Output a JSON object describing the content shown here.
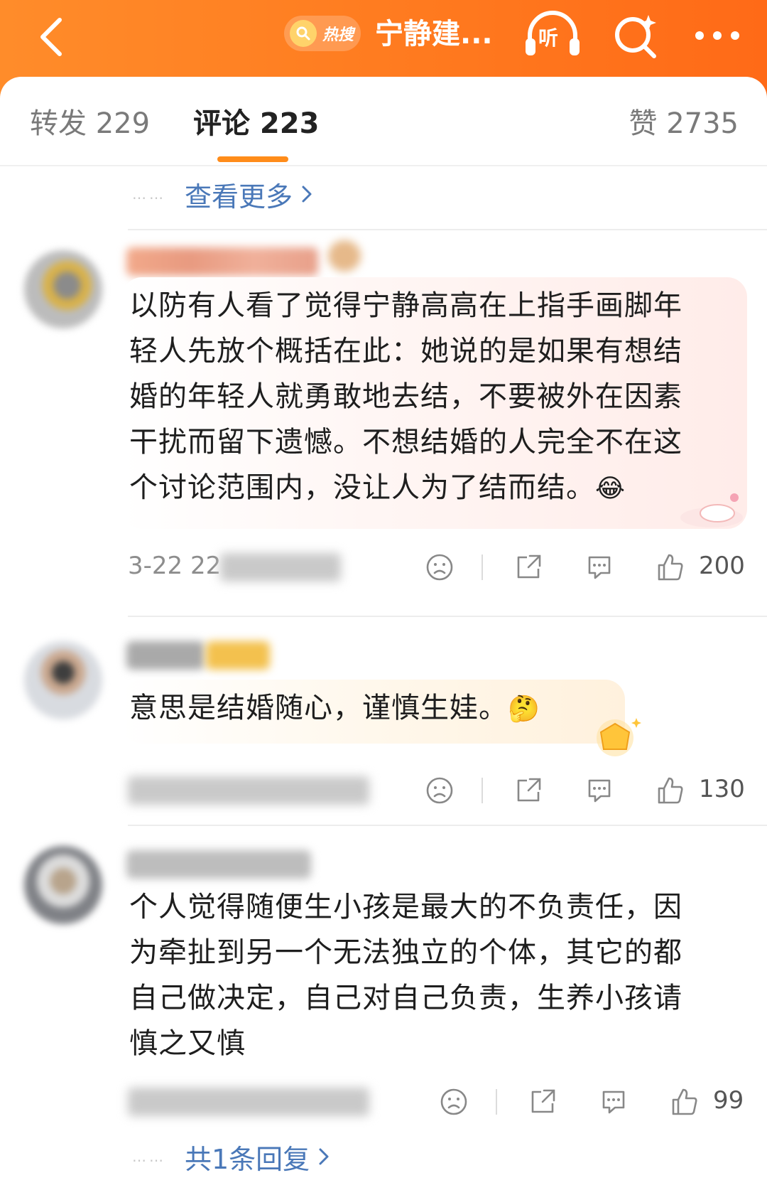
{
  "header": {
    "hot_badge_label": "热搜",
    "title": "宁静建...",
    "listen_label": "听",
    "icons": [
      "back-chevron-icon",
      "search-icon",
      "headphones-icon",
      "ai-search-icon",
      "more-dots-icon"
    ],
    "colors": {
      "bar": "#ff7a1f",
      "accent": "#ff8c1a",
      "link": "#4a78b8"
    }
  },
  "tabs": [
    {
      "label": "转发 229"
    },
    {
      "label": "评论 223"
    },
    {
      "label": "赞 2735"
    }
  ],
  "see_more": {
    "label": "查看更多"
  },
  "comments": [
    {
      "text_lines": [
        "以防有人看了觉得宁静高高在上指手画脚年",
        "轻人先放个概括在此：她说的是如果有想结",
        "婚的年轻人就勇敢地去结，不要被外在因素",
        "干扰而留下遗憾。不想结婚的人完全不在这",
        "个讨论范围内，没让人为了结而结。"
      ],
      "emoji": "😂",
      "timestamp": "3-22 22",
      "likes": "200"
    },
    {
      "text_lines": [
        "意思是结婚随心，谨慎生娃。"
      ],
      "emoji": "🤔",
      "timestamp": "",
      "likes": "130"
    },
    {
      "text_lines": [
        "个人觉得随便生小孩是最大的不负责任，因",
        "为牵扯到另一个无法独立的个体，其它的都",
        "自己做决定，自己对自己负责，生养小孩请",
        "慎之又慎"
      ],
      "emoji": "",
      "timestamp": "",
      "likes": "99"
    }
  ],
  "reply_link": {
    "label": "共1条回复"
  }
}
